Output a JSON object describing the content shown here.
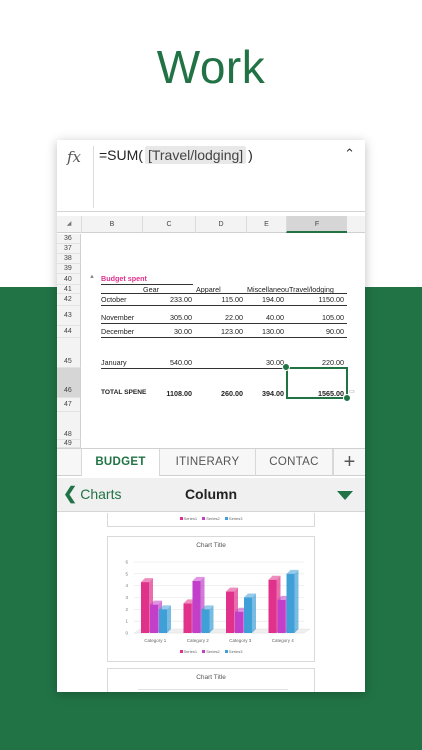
{
  "hero": {
    "title": "Work"
  },
  "formula_bar": {
    "fx_symbol": "fx",
    "prefix": "=SUM(",
    "reference": "[Travel/lodging]",
    "suffix": ")",
    "collapse_icon": "chevron-up-icon"
  },
  "grid": {
    "columns": [
      "B",
      "C",
      "D",
      "E",
      "F"
    ],
    "selected_column": "F",
    "rows": [
      "36",
      "37",
      "38",
      "39",
      "40",
      "41",
      "42",
      "43",
      "44",
      "45",
      "46",
      "47",
      "48",
      "49"
    ],
    "selected_row": "46",
    "title": "Budget spent",
    "headers": [
      "Gear",
      "Apparel",
      "Miscellaneou",
      "Travel/lodging"
    ],
    "data_rows": [
      {
        "label": "October",
        "values": [
          "233.00",
          "115.00",
          "194.00",
          "1150.00"
        ]
      },
      {
        "label": "November",
        "values": [
          "305.00",
          "22.00",
          "40.00",
          "105.00"
        ]
      },
      {
        "label": "December",
        "values": [
          "30.00",
          "123.00",
          "130.00",
          "90.00"
        ]
      },
      {
        "label": "January",
        "values": [
          "540.00",
          "",
          "30.00",
          "220.00"
        ]
      }
    ],
    "total": {
      "label": "TOTAL SPENE",
      "values": [
        "1108.00",
        "260.00",
        "394.00",
        "1565.00"
      ]
    }
  },
  "sheet_tabs": {
    "tabs": [
      "BUDGET",
      "ITINERARY",
      "CONTAC"
    ],
    "active": "BUDGET",
    "add_label": "+"
  },
  "charts_panel": {
    "back_label": "Charts",
    "title": "Column",
    "dropdown_icon": "triangle-down-icon"
  },
  "chart_thumbs": {
    "legend": [
      "Series1",
      "Series2",
      "Series3"
    ],
    "colors": [
      "#e0318b",
      "#c23fc9",
      "#3fa0d8"
    ],
    "title_1": "Chart Title",
    "title_2": "Chart Title"
  },
  "chart_data": {
    "type": "bar",
    "title": "Chart Title",
    "categories": [
      "Category 1",
      "Category 2",
      "Category 3",
      "Category 4"
    ],
    "ylim": [
      0,
      6
    ],
    "yticks": [
      "0",
      "1",
      "2",
      "3",
      "4",
      "5",
      "6"
    ],
    "series": [
      {
        "name": "Series1",
        "values": [
          4.3,
          2.5,
          3.5,
          4.5
        ]
      },
      {
        "name": "Series2",
        "values": [
          2.4,
          4.4,
          1.8,
          2.8
        ]
      },
      {
        "name": "Series3",
        "values": [
          2,
          2,
          3,
          5
        ]
      }
    ],
    "legend": "bottom"
  }
}
